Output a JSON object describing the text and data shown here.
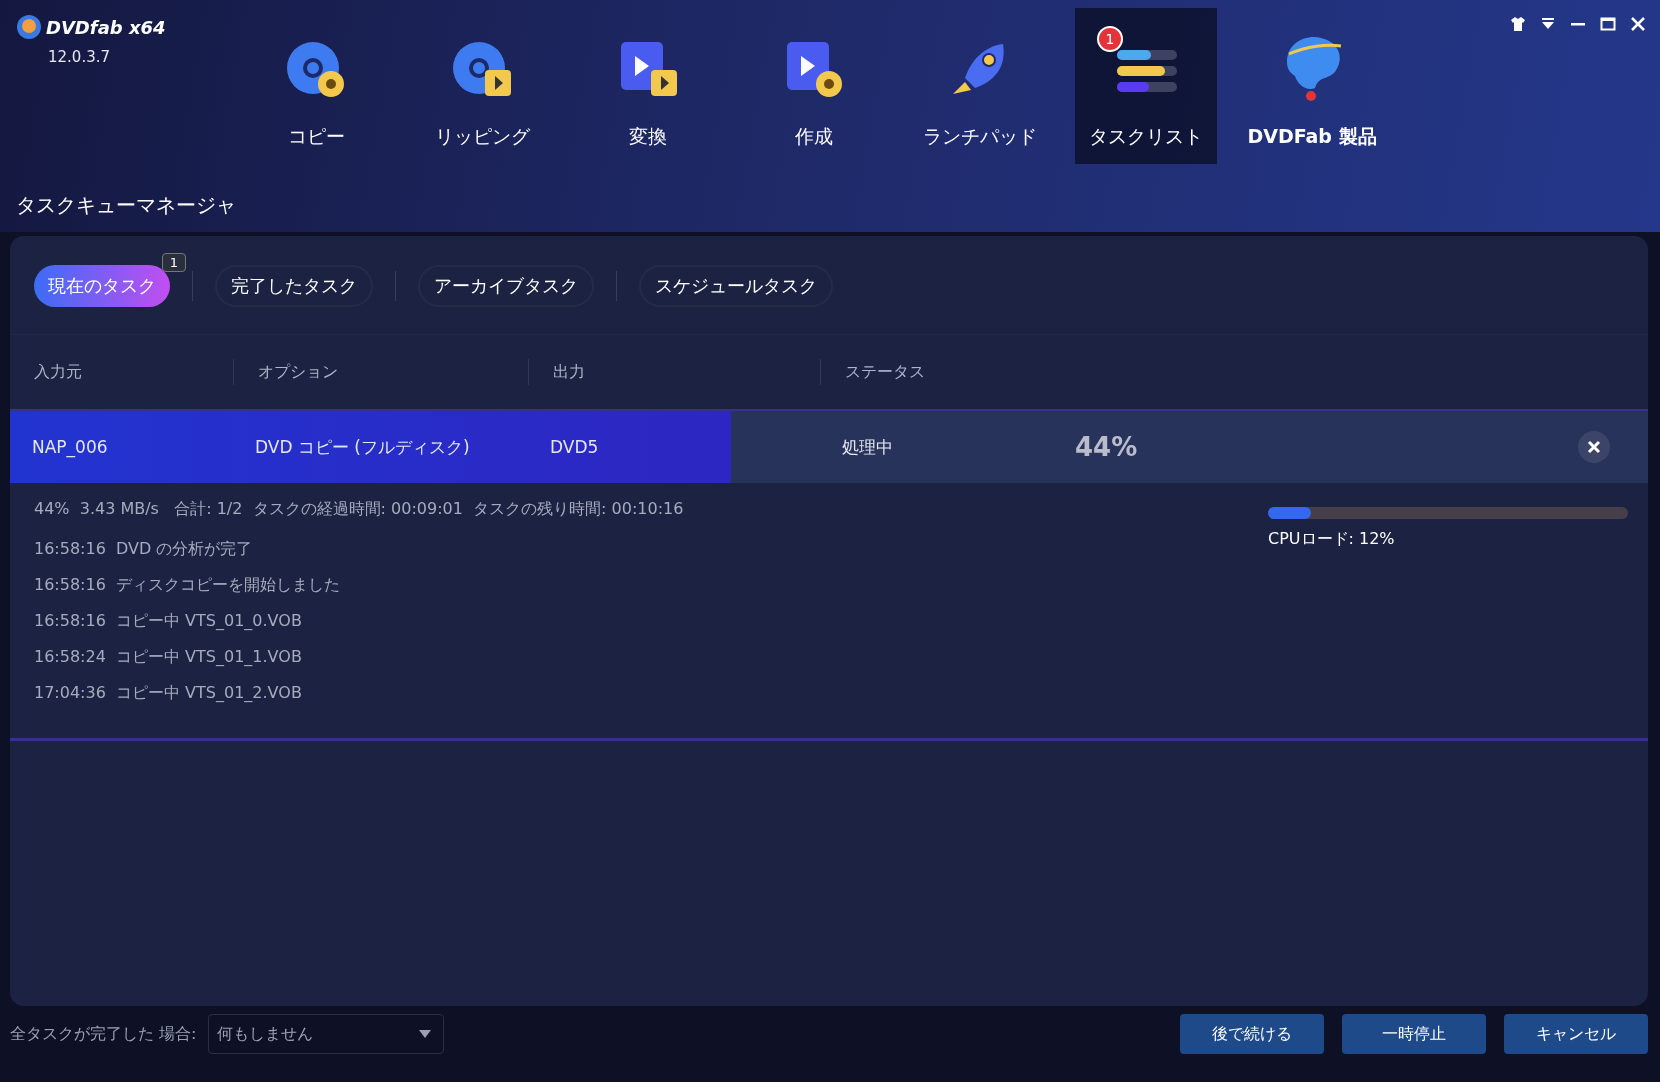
{
  "app": {
    "logo": "DVDfab x64",
    "version": "12.0.3.7"
  },
  "nav": [
    {
      "label": "コピー",
      "selected": false
    },
    {
      "label": "リッピング",
      "selected": false
    },
    {
      "label": "変換",
      "selected": false
    },
    {
      "label": "作成",
      "selected": false
    },
    {
      "label": "ランチパッド",
      "selected": false
    },
    {
      "label": "タスクリスト",
      "selected": true,
      "badge": "1"
    },
    {
      "label": "DVDFab 製品",
      "selected": false
    }
  ],
  "page_title": "タスクキューマネージャ",
  "tabs": [
    {
      "label": "現在のタスク",
      "selected": true,
      "badge": "1"
    },
    {
      "label": "完了したタスク",
      "selected": false
    },
    {
      "label": "アーカイブタスク",
      "selected": false
    },
    {
      "label": "スケジュールタスク",
      "selected": false
    }
  ],
  "table": {
    "columns": [
      "入力元",
      "オプション",
      "出力",
      "ステータス"
    ],
    "rows": [
      {
        "source": "NAP_006",
        "option": "DVD コピー (フルディスク)",
        "output": "DVD5",
        "status": "処理中",
        "percent": "44%",
        "level": 0.44
      }
    ]
  },
  "details": {
    "summary": "44%  3.43 MB/s   合計: 1/2  タスクの経過時間: 00:09:01  タスクの残り時間: 00:10:16",
    "cpu": {
      "label": "CPUロード: 12%",
      "level": 0.12
    },
    "log": [
      "16:58:16  DVD の分析が完了",
      "16:58:16  ディスクコピーを開始しました",
      "16:58:16  コピー中 VTS_01_0.VOB",
      "16:58:24  コピー中 VTS_01_1.VOB",
      "17:04:36  コピー中 VTS_01_2.VOB"
    ]
  },
  "footer": {
    "after_label": "全タスクが完了した 場合:",
    "after_value": "何もしません",
    "buttons": [
      "後で続ける",
      "一時停止",
      "キャンセル"
    ]
  }
}
